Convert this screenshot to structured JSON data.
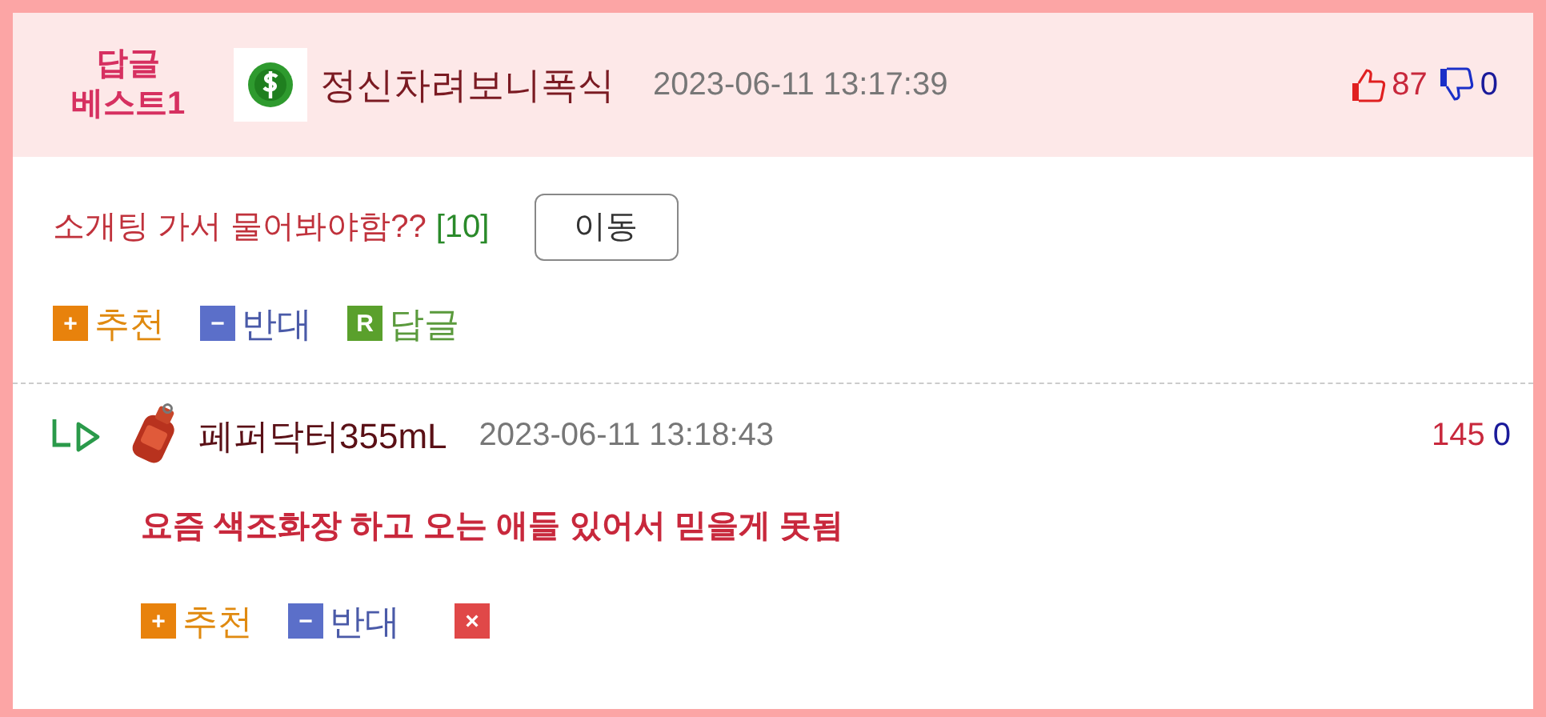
{
  "best_comment": {
    "badge_lines": [
      "답글",
      "베스트1"
    ],
    "author": "정신차려보니폭식",
    "time": "2023-06-11 13:17:39",
    "likes": "87",
    "dislikes": "0"
  },
  "post_link": {
    "title": "소개팅 가서 물어봐야함??",
    "count": "[10]",
    "button": "이동"
  },
  "actions": [
    {
      "kind": "recommend",
      "icon": "+",
      "label": "추천"
    },
    {
      "kind": "oppose",
      "icon": "−",
      "label": "반대"
    },
    {
      "kind": "reply",
      "icon": "R",
      "label": "답글"
    }
  ],
  "reply": {
    "author": "페퍼닥터355mL",
    "time": "2023-06-11 13:18:43",
    "likes": "145",
    "dislikes": "0",
    "text": "요즘 색조화장 하고 오는 애들 있어서 믿을게 못됨",
    "actions": [
      {
        "kind": "recommend",
        "icon": "+",
        "label": "추천"
      },
      {
        "kind": "oppose",
        "icon": "−",
        "label": "반대"
      },
      {
        "kind": "delete",
        "icon": "×"
      }
    ]
  }
}
